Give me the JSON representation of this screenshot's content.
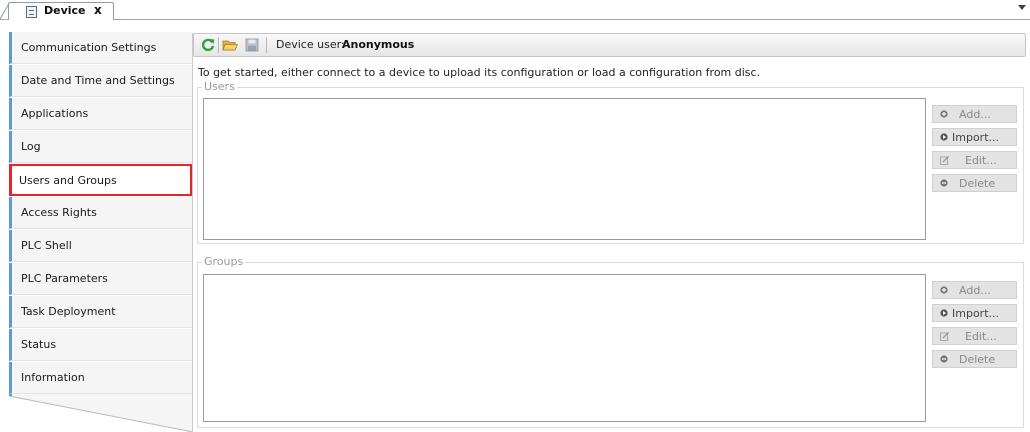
{
  "tab": {
    "title": "Device",
    "close": "x"
  },
  "nav": {
    "items": [
      {
        "label": "Communication Settings",
        "selected": false
      },
      {
        "label": "Date and Time and Settings",
        "selected": false
      },
      {
        "label": "Applications",
        "selected": false
      },
      {
        "label": "Log",
        "selected": false
      },
      {
        "label": "Users and Groups",
        "selected": true
      },
      {
        "label": "Access Rights",
        "selected": false
      },
      {
        "label": "PLC Shell",
        "selected": false
      },
      {
        "label": "PLC Parameters",
        "selected": false
      },
      {
        "label": "Task Deployment",
        "selected": false
      },
      {
        "label": "Status",
        "selected": false
      },
      {
        "label": "Information",
        "selected": false
      }
    ]
  },
  "toolbar": {
    "device_user_label": "Device user:",
    "device_user": "Anonymous",
    "icons": [
      "refresh-icon",
      "open-folder-icon",
      "save-icon"
    ]
  },
  "info_text": "To get started, either connect to a device to upload its configuration or load a configuration from disc.",
  "users": {
    "label": "Users",
    "buttons": {
      "add": "Add...",
      "import": "Import...",
      "edit": "Edit...",
      "delete": "Delete"
    }
  },
  "groups": {
    "label": "Groups",
    "buttons": {
      "add": "Add...",
      "import": "Import...",
      "edit": "Edit...",
      "delete": "Delete"
    }
  },
  "colors": {
    "nav_accent": "#5b9bd5",
    "selection_highlight": "#e0252c",
    "refresh_icon": "#2aa33a",
    "folder_icon": "#e8b23a"
  }
}
